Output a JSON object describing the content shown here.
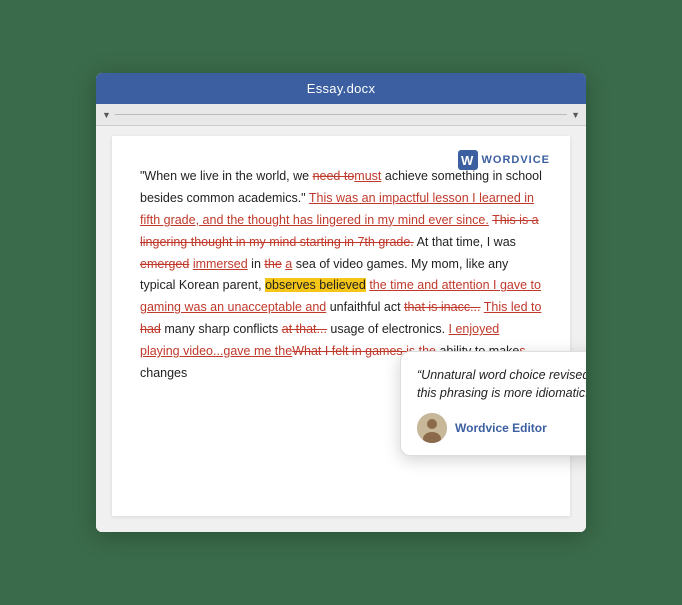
{
  "window": {
    "title": "Essay.docx"
  },
  "ruler": {
    "left_arrow": "▼",
    "right_arrow": "▼"
  },
  "logo": {
    "text": "WORDVICE"
  },
  "doc": {
    "content": [
      {
        "type": "text",
        "value": "“When we live in the world, we "
      },
      {
        "type": "strikethrough",
        "value": "need to"
      },
      {
        "type": "replaced",
        "value": "must"
      },
      {
        "type": "text",
        "value": " achieve something in school besides common academics.” "
      },
      {
        "type": "underline-red",
        "value": "This was an impactful lesson I learned in fifth grade, and the thought has lingered in my mind ever since."
      },
      {
        "type": "text",
        "value": " "
      },
      {
        "type": "strikethrough-red",
        "value": "This is a lingering thought in my mind starting in 7th grade."
      },
      {
        "type": "text",
        "value": " At that time, I was "
      },
      {
        "type": "strikethrough",
        "value": "emerged"
      },
      {
        "type": "text",
        "value": " "
      },
      {
        "type": "replaced",
        "value": "immersed"
      },
      {
        "type": "text",
        "value": " in "
      },
      {
        "type": "strikethrough",
        "value": "the"
      },
      {
        "type": "text",
        "value": " "
      },
      {
        "type": "replaced",
        "value": "a"
      },
      {
        "type": "text",
        "value": " sea of video games. My mom, like any typical Korean parent, "
      },
      {
        "type": "highlight-yellow",
        "value": "observes believed"
      },
      {
        "type": "text",
        "value": " "
      },
      {
        "type": "underline-red",
        "value": "the time and attention I gave to gaming was an unacceptable and"
      },
      {
        "type": "text",
        "value": " unfaithful act "
      },
      {
        "type": "strikethrough-red",
        "value": "that is inacc..."
      },
      {
        "type": "text",
        "value": " "
      },
      {
        "type": "underline-red",
        "value": "This led to"
      },
      {
        "type": "text",
        "value": " "
      },
      {
        "type": "strikethrough",
        "value": "had"
      },
      {
        "type": "text",
        "value": " many sharp conflicts "
      },
      {
        "type": "strikethrough-red",
        "value": "at that..."
      },
      {
        "type": "text",
        "value": " usage of electronics. "
      },
      {
        "type": "underline-red",
        "value": "I enjoyed playing video...gave me the"
      },
      {
        "type": "strikethrough-red",
        "value": "What I felt in games is the"
      },
      {
        "type": "text",
        "value": " ability to make"
      },
      {
        "type": "strikethrough",
        "value": "s"
      },
      {
        "type": "text",
        "value": " changes"
      }
    ]
  },
  "tooltip": {
    "quote": "“Unnatural word choice revised; this phrasing is more idiomatic.”",
    "editor": "Wordvice Editor",
    "avatar_emoji": "👤"
  }
}
